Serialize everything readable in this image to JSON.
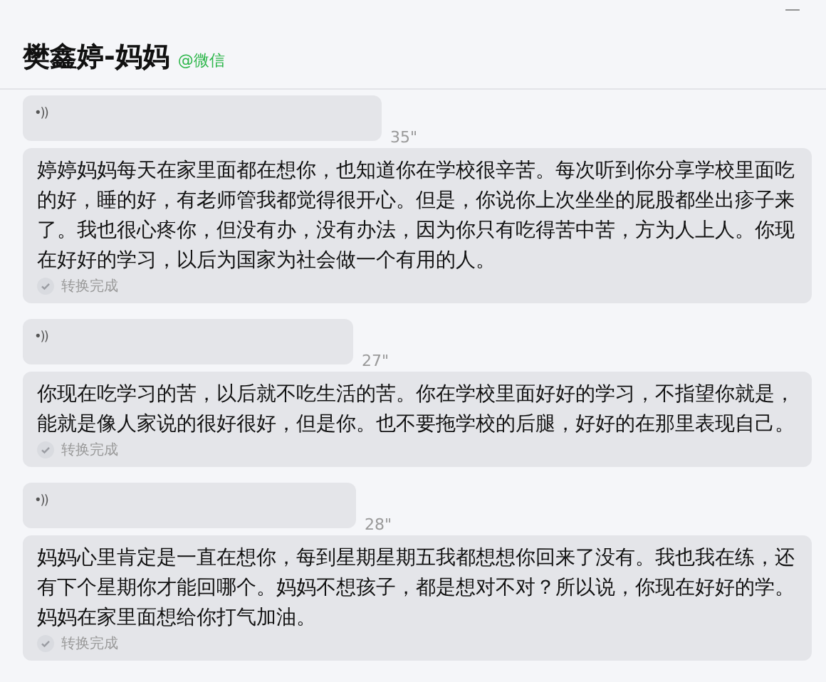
{
  "header": {
    "title": "樊鑫婷-妈妈",
    "source": "@微信",
    "minimize": "—"
  },
  "messages": [
    {
      "voice_icon": "•))",
      "duration": "35\"",
      "transcript": "婷婷妈妈每天在家里面都在想你，也知道你在学校很辛苦。每次听到你分享学校里面吃的好，睡的好，有老师管我都觉得很开心。但是，你说你上次坐坐的屁股都坐出疹子来了。我也很心疼你，但没有办，没有办法，因为你只有吃得苦中苦，方为人上人。你现在好好的学习，以后为国家为社会做一个有用的人。",
      "status": "转换完成"
    },
    {
      "voice_icon": "•))",
      "duration": "27\"",
      "transcript": "你现在吃学习的苦，以后就不吃生活的苦。你在学校里面好好的学习，不指望你就是，能就是像人家说的很好很好，但是你。也不要拖学校的后腿，好好的在那里表现自己。",
      "status": "转换完成"
    },
    {
      "voice_icon": "•))",
      "duration": "28\"",
      "transcript": "妈妈心里肯定是一直在想你，每到星期星期五我都想想你回来了没有。我也我在练，还有下个星期你才能回哪个。妈妈不想孩子，都是想对不对？所以说，你现在好好的学。妈妈在家里面想给你打气加油。",
      "status": "转换完成"
    }
  ]
}
